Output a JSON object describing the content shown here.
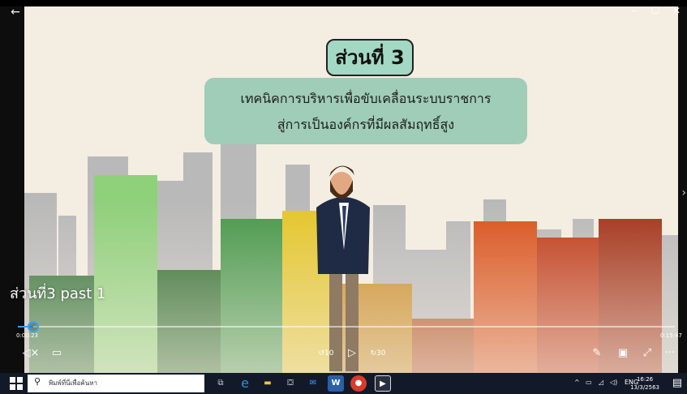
{
  "window": {
    "back_icon": "arrow-left-icon",
    "minimize_label": "–",
    "maximize_label": "☐",
    "close_label": "✕"
  },
  "slide": {
    "section_title": "ส่วนที่ 3",
    "subtitle_line1": "เทคนิคการบริหารเพื่อขับเคลื่อนระบบราชการ",
    "subtitle_line2": "สู่การเป็นองค์กรที่มีผลสัมฤทธิ์สูง"
  },
  "player": {
    "video_title": "ส่วนที่3 past 1",
    "elapsed": "0:00:23",
    "total": "0:15:47",
    "progress_fraction": 0.024,
    "volume_icon": "volume-mute-icon",
    "captions_icon": "captions-icon",
    "skip_back_label": "10",
    "play_icon": "play-icon",
    "skip_forward_label": "30",
    "edit_icon": "pen-icon",
    "miniview_icon": "miniview-icon",
    "fullscreen_icon": "fullscreen-icon",
    "more_icon": "more-icon",
    "accent_color": "#3aa0ff"
  },
  "taskbar": {
    "search_placeholder": "พิมพ์ที่นี่เพื่อค้นหา",
    "lang": "ENG",
    "time": "16:26",
    "date": "13/3/2563"
  }
}
